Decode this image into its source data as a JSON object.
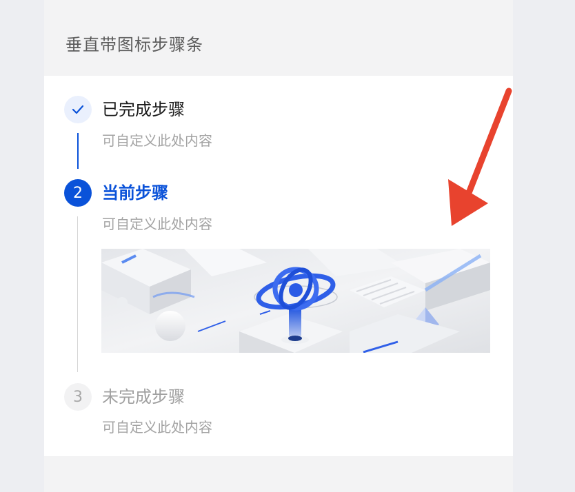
{
  "header": {
    "title": "垂直带图标步骤条"
  },
  "steps": [
    {
      "status": "done",
      "title": "已完成步骤",
      "description": "可自定义此处内容",
      "icon": "check-icon"
    },
    {
      "status": "current",
      "number": "2",
      "title": "当前步骤",
      "description": "可自定义此处内容"
    },
    {
      "status": "pending",
      "number": "3",
      "title": "未完成步骤",
      "description": "可自定义此处内容"
    }
  ],
  "colors": {
    "accent": "#0a52d9",
    "done_icon_bg": "#eaf0fd",
    "pending_text": "#a0a0a0",
    "annotation_arrow": "#e8432e"
  },
  "illustration": {
    "icon": "isometric-3d-illustration"
  },
  "annotation": {
    "icon": "red-arrow-icon"
  }
}
